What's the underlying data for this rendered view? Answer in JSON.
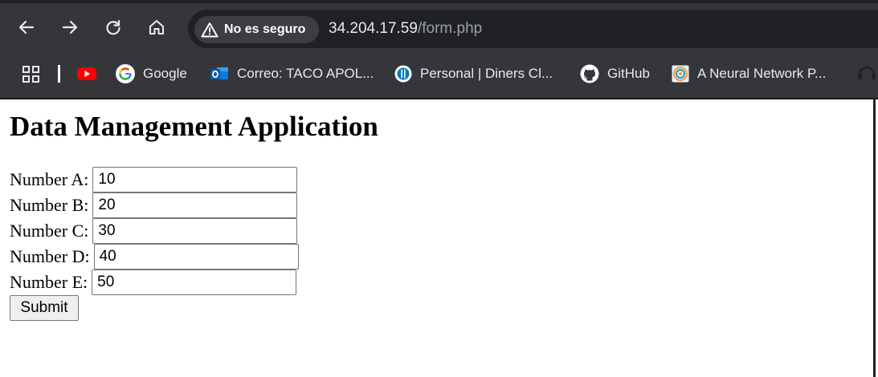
{
  "browser": {
    "security_label": "No es seguro",
    "url_host": "34.204.17.59",
    "url_path": "/form.php",
    "bookmarks": [
      {
        "label": "Google",
        "icon": "google-icon"
      },
      {
        "label": "Correo: TACO APOL...",
        "icon": "outlook-icon"
      },
      {
        "label": "Personal | Diners Cl...",
        "icon": "diners-icon"
      },
      {
        "label": "GitHub",
        "icon": "github-icon"
      },
      {
        "label": "A Neural Network P...",
        "icon": "playground-icon"
      }
    ]
  },
  "page": {
    "title": "Data Management Application",
    "fields": [
      {
        "label": "Number A:",
        "value": "10"
      },
      {
        "label": "Number B:",
        "value": "20"
      },
      {
        "label": "Number C:",
        "value": "30"
      },
      {
        "label": "Number D:",
        "value": "40"
      },
      {
        "label": "Number E:",
        "value": "50"
      }
    ],
    "submit_label": "Submit"
  }
}
